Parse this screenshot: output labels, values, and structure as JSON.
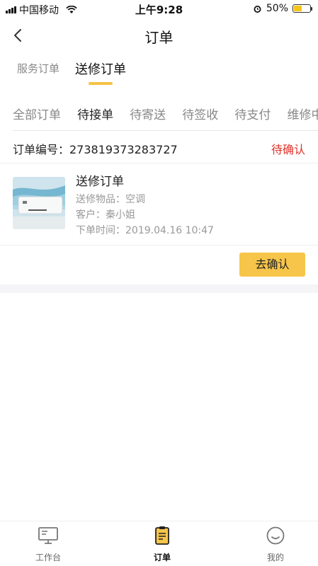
{
  "status_bar": {
    "carrier": "中国移动",
    "time": "上午9:28",
    "battery_percent": "50%",
    "battery_level": 0.5
  },
  "header": {
    "title": "订单"
  },
  "type_tabs": [
    {
      "label": "服务订单",
      "active": false
    },
    {
      "label": "送修订单",
      "active": true
    }
  ],
  "status_tabs": [
    {
      "label": "全部订单",
      "active": false
    },
    {
      "label": "待接单",
      "active": true
    },
    {
      "label": "待寄送",
      "active": false
    },
    {
      "label": "待签收",
      "active": false
    },
    {
      "label": "待支付",
      "active": false
    },
    {
      "label": "维修中",
      "active": false
    }
  ],
  "order": {
    "number_text": "订单编号：273819373283727",
    "status": "待确认",
    "title": "送修订单",
    "item_text": "送修物品：空调",
    "customer_text": "客户：秦小姐",
    "time_text": "下单时间：2019.04.16  10:47",
    "action_label": "去确认"
  },
  "tabbar": {
    "items": [
      {
        "label": "工作台",
        "icon": "monitor-icon",
        "active": false
      },
      {
        "label": "订单",
        "icon": "clipboard-icon",
        "active": true
      },
      {
        "label": "我的",
        "icon": "smile-icon",
        "active": false
      }
    ]
  },
  "colors": {
    "accent": "#f7c54a",
    "status_red": "#e0322a"
  }
}
